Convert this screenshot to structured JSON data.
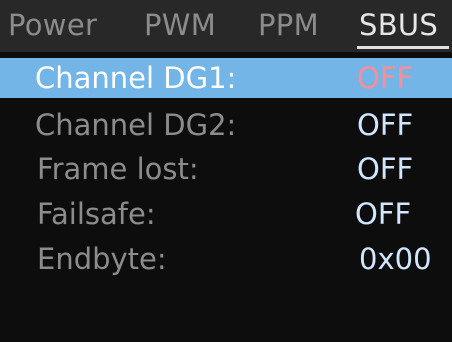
{
  "tabs": [
    {
      "label": "Power",
      "active": false
    },
    {
      "label": "PWM",
      "active": false
    },
    {
      "label": "PPM",
      "active": false
    },
    {
      "label": "SBUS",
      "active": true
    }
  ],
  "rows": [
    {
      "label": "Channel DG1:",
      "value": "OFF",
      "selected": true
    },
    {
      "label": "Channel DG2:",
      "value": "OFF",
      "selected": false
    },
    {
      "label": "Frame lost:",
      "value": "OFF",
      "selected": false
    },
    {
      "label": "Failsafe:",
      "value": "OFF",
      "selected": false
    },
    {
      "label": "Endbyte:",
      "value": "0x00",
      "selected": false
    }
  ],
  "colors": {
    "background": "#0d0d0d",
    "tab_bar": "#282828",
    "tab_inactive": "#8c8c8c",
    "tab_active": "#e6e6e6",
    "selected_row": "#74b5e8",
    "selected_value": "#ff8c96",
    "label": "#8c8c8c",
    "value": "#d2e6ff"
  }
}
